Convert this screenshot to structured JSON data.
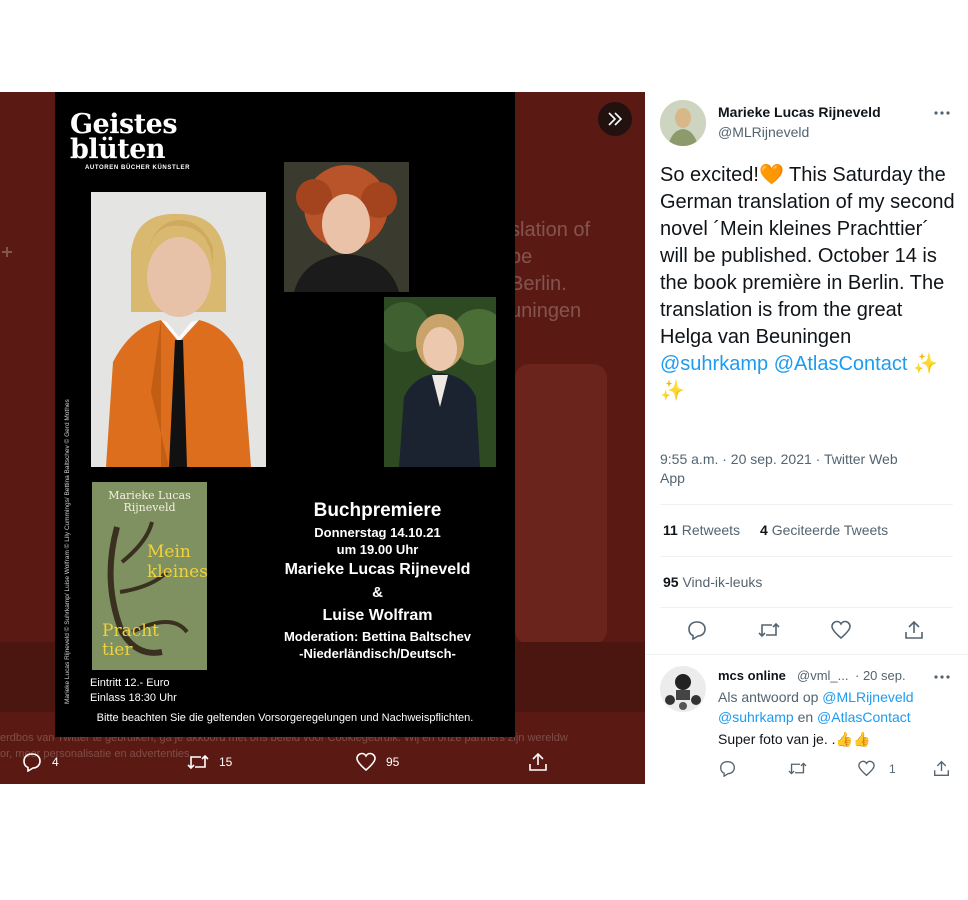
{
  "background": {
    "ghost_lines": [
      "slation of",
      "be",
      "Berlin.",
      "uningen"
    ],
    "cookie_line_1": "erdbos van Twitter te gebruiken, ga je akkoord met ons beleid voor Cookiegebruik. Wij en onze partners zijn wereldw",
    "cookie_line_2": "or, meer personalisatie en advertenties."
  },
  "poster": {
    "brand_line1": "Geistes",
    "brand_line2": "blüten",
    "brand_sub": "AUTOREN BÜCHER KÜNSTLER",
    "credit": "Marieke Lucas Rijneveld © Suhrkamp/ Luise Wolfram © Lily Cummings/ Bettina Baltschev © Gerd Mothes",
    "book_author": "Marieke Lucas Rijneveld",
    "book_title_top": "Mein kleines",
    "book_title_bottom": "Pracht tier",
    "entry_price": "Eintritt 12.- Euro",
    "entry_time": "Einlass 18:30 Uhr",
    "event_title": "Buchpremiere",
    "event_date": "Donnerstag 14.10.21",
    "event_time": "um 19.00 Uhr",
    "event_author": "Marieke Lucas Rijneveld",
    "event_amp": "&",
    "event_guest": "Luise Wolfram",
    "event_moderation": "Moderation: Bettina Baltschev",
    "event_language": "-Niederländisch/Deutsch-",
    "notice": "Bitte beachten Sie die geltenden Vorsorgeregelungen und Nachweispflichten."
  },
  "media_actions": {
    "replies": "4",
    "retweets": "15",
    "likes": "95"
  },
  "tweet": {
    "author_name": "Marieke Lucas Rijneveld",
    "author_handle": "@MLRijneveld",
    "text_1": "So excited!",
    "heart_emoji": "🧡",
    "text_2": " This Saturday the German translation of my second novel ´Mein kleines Prachttier´ will be published. October 14 is the book première in Berlin. The translation is from the great Helga van Beuningen ",
    "mention_1": "@suhrkamp",
    "mention_2": "@AtlasContact",
    "sparkles": "✨ ✨",
    "timestamp": "9:55 a.m. · 20 sep. 2021 · Twitter Web App",
    "retweets_count": "11",
    "retweets_label": "Retweets",
    "quotes_count": "4",
    "quotes_label": "Geciteerde Tweets",
    "likes_count": "95",
    "likes_label": "Vind-ik-leuks"
  },
  "reply": {
    "name": "mcs online",
    "handle": "@vml_...",
    "time": "· 20 sep.",
    "replying_label": "Als antwoord op ",
    "replying_to_1": "@MLRijneveld",
    "replying_to_2": "@suhrkamp",
    "replying_and": " en ",
    "replying_to_3": "@AtlasContact",
    "text": "Super foto van je. .",
    "thumbs": "👍👍",
    "likes": "1"
  },
  "colors": {
    "viewer_bg": "#5a1a13",
    "accent": "#1d9bf0",
    "orange_heart": "#f4900c"
  }
}
